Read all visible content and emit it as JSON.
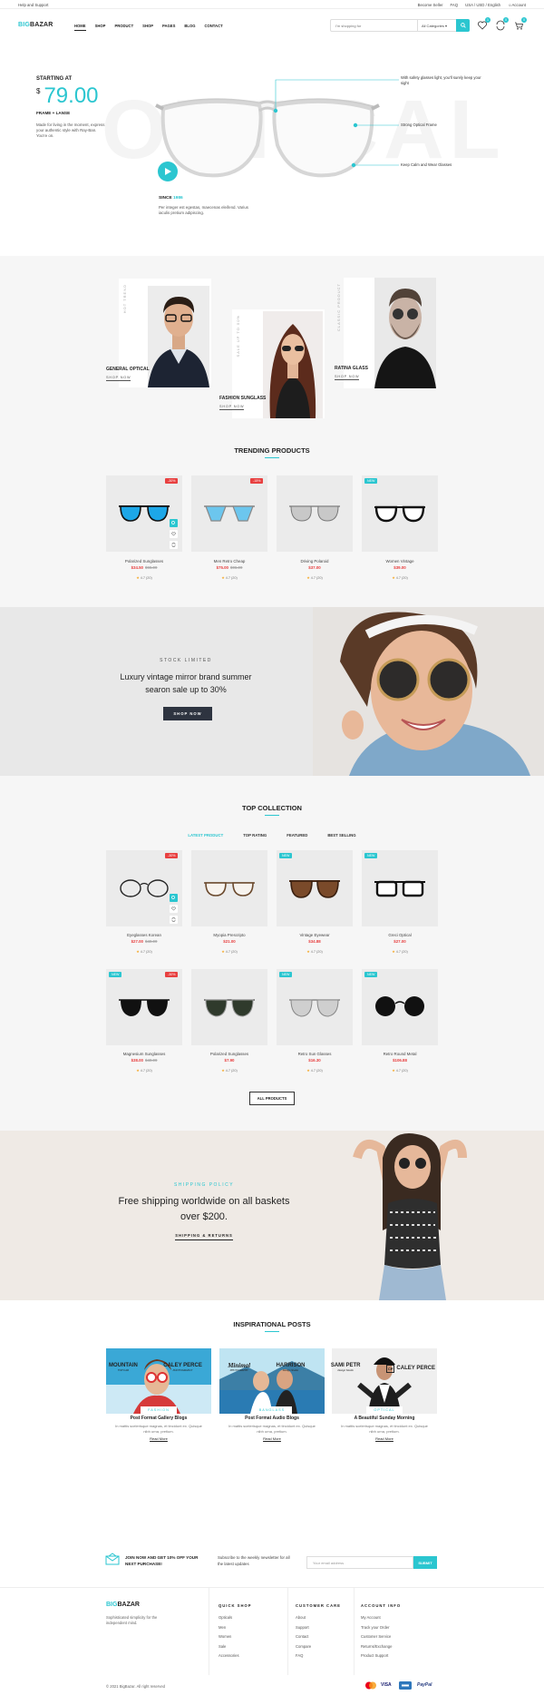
{
  "topbar": {
    "help": "Help and Support",
    "seller": "Become Seller",
    "faq": "FAQ",
    "locale": "USA / USD / English",
    "account": "Account"
  },
  "header": {
    "logo_a": "BIG",
    "logo_b": "BAZAR",
    "nav": [
      "HOME",
      "SHOP",
      "PRODUCT",
      "SHOP",
      "PAGES",
      "BLOG",
      "CONTACT"
    ],
    "search_placeholder": "I'm shopping for",
    "category": "All Categories",
    "wishlist_count": "1",
    "compare_count": "0",
    "cart_count": "0"
  },
  "hero": {
    "bigword": "OPTICAL",
    "starting": "STARTING AT",
    "currency": "$",
    "price": "79.00",
    "frame": "FRAME + LANSE",
    "desc": "Made for living in the moment, express your authentic style with Ray-Ban. You're on.",
    "since_label": "SINCE",
    "since_year": "1986",
    "since_desc": "Per integer est egestas, maecenas eleifend. Varius iaculis pretium adipiscing.",
    "features": [
      "With safety glasses light, you'll surely keep your sight",
      "Strong Optical Frame",
      "Keep Calm and Wear Glasses"
    ]
  },
  "categories": [
    {
      "vlabel": "HOT TREND",
      "name": "GENERAL OPTICAL",
      "shop": "SHOP NOW"
    },
    {
      "vlabel": "SALE UP TO 50%",
      "name": "FASHION SUNGLASS",
      "shop": "SHOP NOW"
    },
    {
      "vlabel": "CLASSIC PRODUCT",
      "name": "RATINA GLASS",
      "shop": "SHOP NOW"
    }
  ],
  "trending": {
    "title": "TRENDING PRODUCTS",
    "products": [
      {
        "name": "Polarized Sunglasses",
        "price": "$34.50",
        "old": "$55.00",
        "rating": "4.7 (20)",
        "tag": "-30%"
      },
      {
        "name": "Men Retro Cheap",
        "price": "$75.00",
        "old": "$96.00",
        "rating": "4.7 (20)",
        "tag": "-15%"
      },
      {
        "name": "Driving Polaroid",
        "price": "$37.00",
        "old": "",
        "rating": "4.7 (20)",
        "tag": ""
      },
      {
        "name": "Women Vintage",
        "price": "$39.00",
        "old": "",
        "rating": "4.7 (20)",
        "tag": "NEW"
      }
    ]
  },
  "promo": {
    "sub": "STOCK LIMITED",
    "text": "Luxury vintage mirror brand summer searon sale up to 30%",
    "button": "SHOP NOW"
  },
  "collection": {
    "title": "TOP COLLECTION",
    "tabs": [
      "LATEST PRODUCT",
      "TOP RATING",
      "FEATURED",
      "BEST SELLING"
    ],
    "products": [
      {
        "name": "Eyeglasses Korean",
        "price": "$27.00",
        "old": "$40.00",
        "rating": "4.7 (20)",
        "tag": "-30%"
      },
      {
        "name": "Myopia Prescripto",
        "price": "$21.00",
        "old": "",
        "rating": "4.7 (20)",
        "tag": ""
      },
      {
        "name": "Vintage Eyewear",
        "price": "$34.88",
        "old": "",
        "rating": "4.7 (20)",
        "tag": "NEW"
      },
      {
        "name": "Greci Optical",
        "price": "$27.00",
        "old": "",
        "rating": "4.7 (20)",
        "tag": "NEW"
      },
      {
        "name": "Magnesium Sunglasses",
        "price": "$38.00",
        "old": "$40.00",
        "rating": "4.7 (20)",
        "tag": "-30%",
        "tag2": "NEW"
      },
      {
        "name": "Polarized Sunglasses",
        "price": "$7.90",
        "old": "",
        "rating": "4.7 (20)",
        "tag": ""
      },
      {
        "name": "Retro Sun Glasses",
        "price": "$16.30",
        "old": "",
        "rating": "4.7 (20)",
        "tag": "NEW"
      },
      {
        "name": "Retro Round Metal",
        "price": "$106.88",
        "old": "",
        "rating": "4.7 (20)",
        "tag": "NEW"
      }
    ],
    "button": "ALL PRODUCTS"
  },
  "shipping": {
    "sub": "SHIPPING POLICY",
    "text": "Free shipping worldwide on all baskets over $200.",
    "link": "SHIPPING & RETURNS"
  },
  "posts": {
    "title": "INSPIRATIONAL POSTS",
    "items": [
      {
        "tag": "FASHION",
        "title": "Post Format Gallery Blogs",
        "excerpt": "In mattis scelerisque magnas, et tincidunt ex. Quisque nibh urna, pretium.",
        "more": "Read More"
      },
      {
        "tag": "BANGLASS",
        "title": "Post Format Audio Blogs",
        "excerpt": "In mattis scelerisque magnas, et tincidunt ex. Quisque nibh urna, pretium.",
        "more": "Read More"
      },
      {
        "tag": "OPTICAL",
        "title": "A Beautiful Sunday Morning",
        "excerpt": "In mattis scelerisque magnas, et tincidunt ex. Quisque nibh urna, pretium.",
        "more": "Read More"
      }
    ]
  },
  "brands": [
    {
      "name": "MOUNTAIN",
      "sub": "TOP CAR"
    },
    {
      "name": "CALEY PERCE",
      "sub": "PHOTOGRAPHY"
    },
    {
      "name": "Minimal",
      "sub": "PHOTOGRAPHY"
    },
    {
      "name": "HARRISON",
      "sub": "Design Studio"
    },
    {
      "name": "SAMI PETR",
      "sub": "Design Studio"
    },
    {
      "name": "CALEY PERCE",
      "sub": "CP"
    }
  ],
  "newsletter": {
    "promo": "JOIN NOW AND GET 10% OFF YOUR NEXT PURCHASE!",
    "text": "Subscribe to the weekly newsletter for all the latest updates",
    "placeholder": "Your email address",
    "button": "SUBMIT"
  },
  "footer": {
    "logo_a": "BIG",
    "logo_b": "BAZAR",
    "desc": "Sophisticated simplicity for the independent mind.",
    "cols": [
      {
        "h": "QUICK SHOP",
        "items": [
          "Opticals",
          "Men",
          "Women",
          "Sale",
          "Accessories"
        ]
      },
      {
        "h": "CUSTOMER CARE",
        "items": [
          "About",
          "Support",
          "Contact",
          "Compare",
          "FAQ"
        ]
      },
      {
        "h": "ACCOUNT INFO",
        "items": [
          "My Account",
          "Track your Order",
          "Customer Service",
          "Returns/Exchange",
          "Product Support"
        ]
      }
    ],
    "copyright": "© 2021 BigBazar. All right reserved",
    "payments": [
      "VISA",
      "PayPal"
    ]
  },
  "colors": {
    "accent": "#2bc6d0",
    "sale": "#e84040",
    "dark": "#2e3440"
  }
}
